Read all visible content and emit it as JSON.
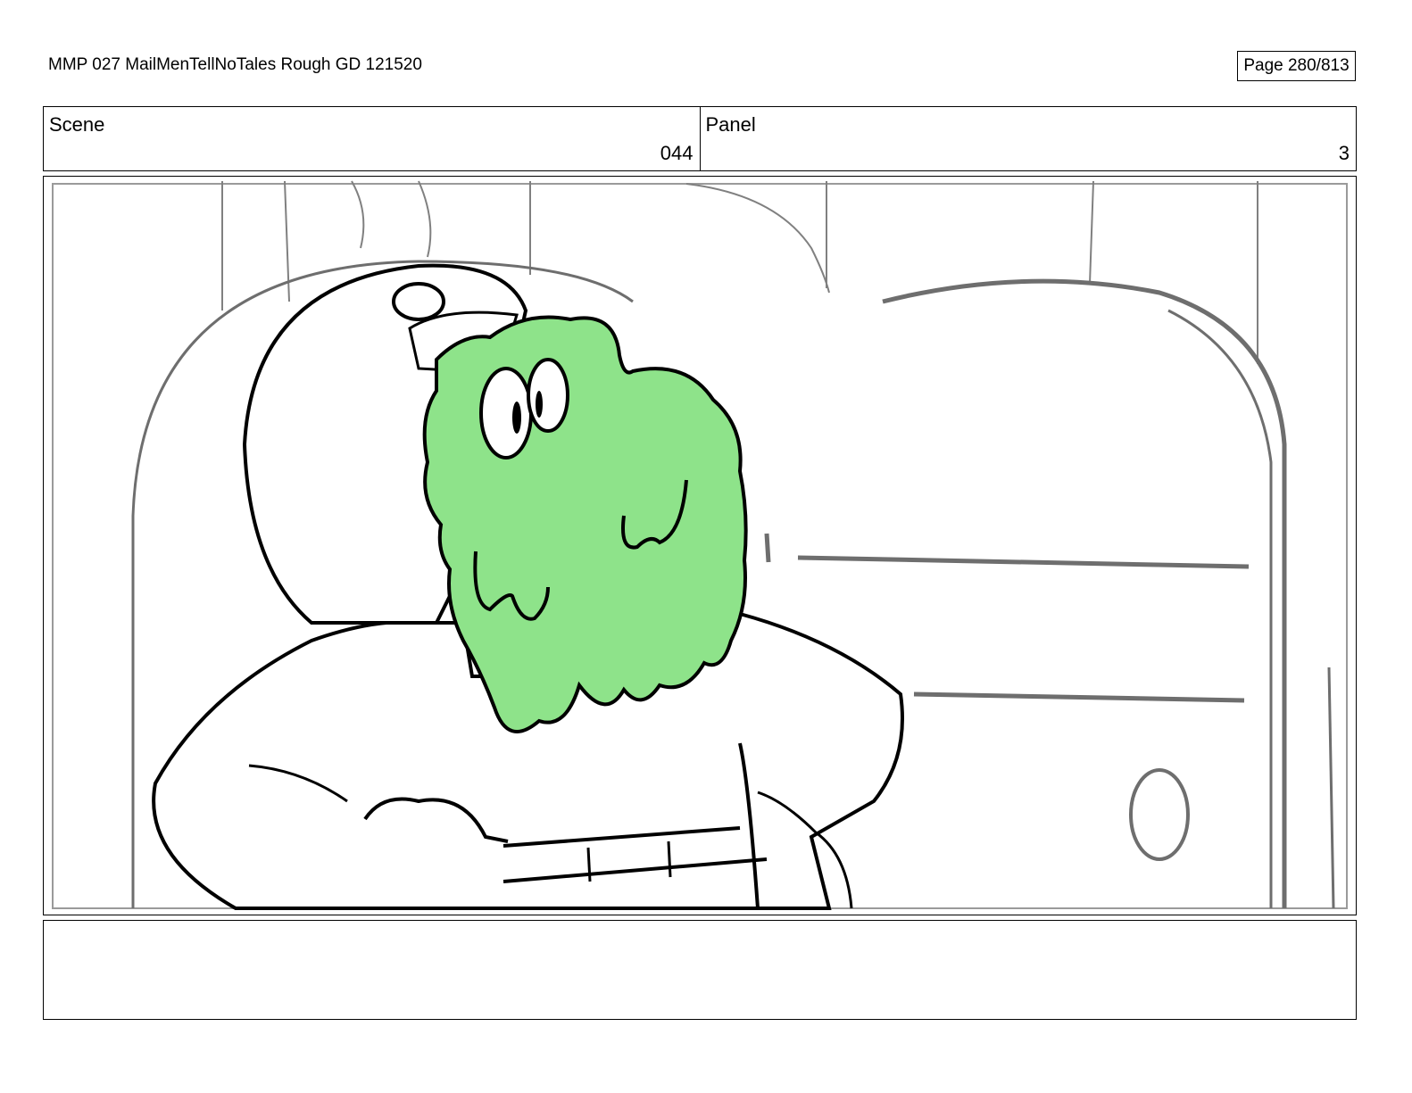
{
  "header": {
    "document_title": "MMP 027 MailMenTellNoTales Rough GD 121520",
    "page_label": "Page 280/813"
  },
  "scene": {
    "label": "Scene",
    "value": "044"
  },
  "panel": {
    "label": "Panel",
    "value": "3"
  },
  "drawing": {
    "slime_color": "#8ee38a",
    "line_color": "#000000",
    "background_line_color": "#6e6e6e"
  },
  "notes": {
    "text": ""
  }
}
